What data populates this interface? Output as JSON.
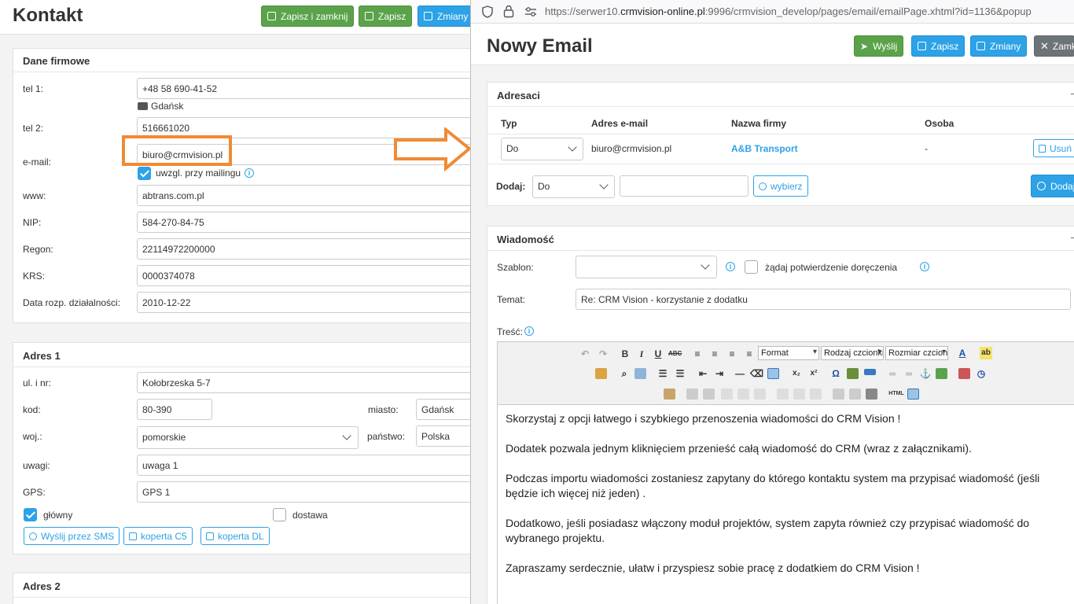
{
  "left": {
    "title": "Kontakt",
    "buttons": {
      "save_close": "Zapisz i zamknij",
      "save": "Zapisz",
      "changes": "Zmiany"
    },
    "company": {
      "title": "Dane firmowe",
      "tel1_label": "tel 1:",
      "tel1": "+48 58 690-41-52",
      "tel1_city": "Gdańsk",
      "tel2_label": "tel 2:",
      "tel2": "516661020",
      "email_label": "e-mail:",
      "email": "biuro@crmvision.pl",
      "mailing_label": "uwzgl. przy mailingu",
      "www_label": "www:",
      "www": "abtrans.com.pl",
      "nip_label": "NIP:",
      "nip": "584-270-84-75",
      "regon_label": "Regon:",
      "regon": "22114972200000",
      "krs_label": "KRS:",
      "krs": "0000374078",
      "date_label": "Data rozp. działalności:",
      "date": "2010-12-22"
    },
    "address1": {
      "title": "Adres 1",
      "street_label": "ul. i nr:",
      "street": "Kołobrzeska 5-7",
      "code_label": "kod:",
      "code": "80-390",
      "city_label": "miasto:",
      "city": "Gdańsk",
      "voiv_label": "woj.:",
      "voiv": "pomorskie",
      "country_label": "państwo:",
      "country": "Polska",
      "notes_label": "uwagi:",
      "notes": "uwaga 1",
      "gps_label": "GPS:",
      "gps": "GPS 1",
      "main_label": "główny",
      "delivery_label": "dostawa",
      "sms_btn": "Wyślij przez SMS",
      "c5_btn": "koperta C5",
      "dl_btn": "koperta DL"
    },
    "address2": {
      "title": "Adres 2"
    }
  },
  "popup": {
    "url_prefix": "https://serwer10.",
    "url_domain": "crmvision-online.pl",
    "url_rest": ":9996/crmvision_develop/pages/email/emailPage.xhtml?id=1136&popup",
    "title": "Nowy Email",
    "buttons": {
      "send": "Wyślij",
      "save": "Zapisz",
      "changes": "Zmiany",
      "close": "Zamk"
    },
    "recipients": {
      "title": "Adresaci",
      "col_type": "Typ",
      "col_email": "Adres e-mail",
      "col_company": "Nazwa firmy",
      "col_person": "Osoba",
      "row": {
        "type": "Do",
        "email": "biuro@crmvision.pl",
        "company": "A&B Transport",
        "person": "-",
        "remove": "Usuń"
      },
      "add_label": "Dodaj:",
      "add_type": "Do",
      "add_input": "",
      "choose_btn": "wybierz",
      "add_btn": "Dodaj"
    },
    "message": {
      "title": "Wiadomość",
      "template_label": "Szablon:",
      "template_value": "",
      "confirm_label": "żądaj potwierdzenie doręczenia",
      "subject_label": "Temat:",
      "subject": "Re: CRM Vision - korzystanie z dodatku",
      "body_label": "Treść:",
      "toolbar": {
        "format": "Format",
        "font": "Rodzaj czcionki",
        "size": "Rozmiar czcionki"
      },
      "body": [
        "Skorzystaj z opcji łatwego i szybkiego przenoszenia wiadomości do CRM Vision !",
        "Dodatek pozwala jednym kliknięciem przenieść całą wiadomość do CRM  (wraz z załącznikami).",
        "Podczas importu wiadomości zostaniesz zapytany do którego kontaktu system ma przypisać wiadomość (jeśli będzie ich więcej niż jeden) .",
        "Dodatkowo, jeśli posiadasz włączony moduł projektów, system zapyta również czy przypisać wiadomość do wybranego projektu.",
        "Zapraszamy serdecznie, ułatw i przyspiesz sobie pracę z dodatkiem do CRM Vision !"
      ]
    }
  }
}
